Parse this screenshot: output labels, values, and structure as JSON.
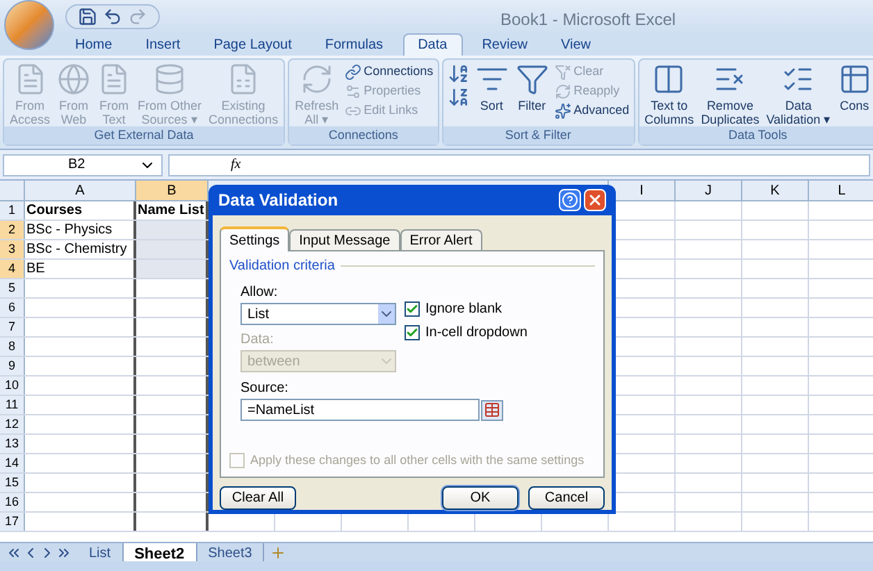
{
  "window": {
    "title": "Book1 - Microsoft Excel"
  },
  "ribbon_tabs": [
    {
      "label": "Home",
      "selected": false
    },
    {
      "label": "Insert",
      "selected": false
    },
    {
      "label": "Page Layout",
      "selected": false
    },
    {
      "label": "Formulas",
      "selected": false
    },
    {
      "label": "Data",
      "selected": true
    },
    {
      "label": "Review",
      "selected": false
    },
    {
      "label": "View",
      "selected": false
    }
  ],
  "ribbon_groups": [
    {
      "title": "Get External Data",
      "columns": [
        [
          {
            "kind": "large",
            "label": "From\nAccess",
            "disabled": true
          }
        ],
        [
          {
            "kind": "large",
            "label": "From\nWeb",
            "disabled": true
          }
        ],
        [
          {
            "kind": "large",
            "label": "From\nText",
            "disabled": true
          }
        ],
        [
          {
            "kind": "large",
            "label": "From Other\nSources ▾",
            "disabled": true
          }
        ],
        [
          {
            "kind": "large",
            "label": "Existing\nConnections",
            "disabled": true
          }
        ]
      ]
    },
    {
      "title": "Connections",
      "columns": [
        [
          {
            "kind": "large",
            "label": "Refresh\nAll ▾",
            "disabled": true
          }
        ],
        [
          {
            "kind": "small",
            "label": "Connections",
            "disabled": false
          },
          {
            "kind": "small",
            "label": "Properties",
            "disabled": true
          },
          {
            "kind": "small",
            "label": "Edit Links",
            "disabled": true
          }
        ]
      ]
    },
    {
      "title": "Sort & Filter",
      "columns": [
        [
          {
            "kind": "icon",
            "disabled": false
          },
          {
            "kind": "icon",
            "disabled": false
          }
        ],
        [
          {
            "kind": "large",
            "label": "Sort",
            "disabled": false
          }
        ],
        [
          {
            "kind": "large",
            "label": "Filter",
            "disabled": false
          }
        ],
        [
          {
            "kind": "small",
            "label": "Clear",
            "disabled": true
          },
          {
            "kind": "small",
            "label": "Reapply",
            "disabled": true
          },
          {
            "kind": "small",
            "label": "Advanced",
            "disabled": false
          }
        ]
      ]
    },
    {
      "title": "Data Tools",
      "columns": [
        [
          {
            "kind": "large",
            "label": "Text to\nColumns",
            "disabled": false
          }
        ],
        [
          {
            "kind": "large",
            "label": "Remove\nDuplicates",
            "disabled": false
          }
        ],
        [
          {
            "kind": "large",
            "label": "Data\nValidation ▾",
            "disabled": false
          }
        ],
        [
          {
            "kind": "large",
            "label": "Cons",
            "disabled": false
          }
        ]
      ]
    }
  ],
  "formula_bar": {
    "name_box": "B2",
    "function_label": "fx"
  },
  "sheet": {
    "left_columns": [
      {
        "label": "A",
        "selected": false
      },
      {
        "label": "B",
        "selected": true
      }
    ],
    "right_columns": [
      "I",
      "J",
      "K",
      "L"
    ],
    "rows": [
      {
        "number": "1",
        "cells": [
          "Courses",
          "Name List"
        ],
        "selected": false
      },
      {
        "number": "2",
        "cells": [
          "BSc - Physics"
        ],
        "selected": true
      },
      {
        "number": "3",
        "cells": [
          "BSc - Chemistry"
        ],
        "selected": true
      },
      {
        "number": "4",
        "cells": [
          "BE"
        ],
        "selected": true
      },
      {
        "number": "5",
        "selected": false
      },
      {
        "number": "6",
        "selected": false
      },
      {
        "number": "7",
        "selected": false
      },
      {
        "number": "8",
        "selected": false
      },
      {
        "number": "9",
        "selected": false
      },
      {
        "number": "10",
        "selected": false
      },
      {
        "number": "11",
        "selected": false
      },
      {
        "number": "12",
        "selected": false
      },
      {
        "number": "13",
        "selected": false
      },
      {
        "number": "14",
        "selected": false
      },
      {
        "number": "15",
        "selected": false
      },
      {
        "number": "16",
        "selected": false
      },
      {
        "number": "17",
        "selected": false
      }
    ]
  },
  "sheet_tabs": [
    {
      "label": "List",
      "selected": false
    },
    {
      "label": "Sheet2",
      "selected": true
    },
    {
      "label": "Sheet3",
      "selected": false
    }
  ],
  "dialog": {
    "title": "Data Validation",
    "tabs": [
      {
        "label": "Settings",
        "selected": true
      },
      {
        "label": "Input Message",
        "selected": false
      },
      {
        "label": "Error Alert",
        "selected": false
      }
    ],
    "group_title": "Validation criteria",
    "allow": {
      "label": "Allow:",
      "value": "List",
      "disabled": false
    },
    "data": {
      "label": "Data:",
      "value": "between",
      "disabled": true
    },
    "checkboxes": [
      {
        "label": "Ignore blank",
        "checked": true,
        "disabled": false
      },
      {
        "label": "In-cell dropdown",
        "checked": true,
        "disabled": false
      }
    ],
    "source": {
      "label": "Source:",
      "value": "=NameList"
    },
    "apply_all": {
      "label": "Apply these changes to all other cells with the same settings",
      "checked": false,
      "disabled": true
    },
    "buttons": [
      {
        "label": "Clear All",
        "kind": "left"
      },
      {
        "label": "OK",
        "kind": "default"
      },
      {
        "label": "Cancel",
        "kind": "normal"
      }
    ]
  }
}
